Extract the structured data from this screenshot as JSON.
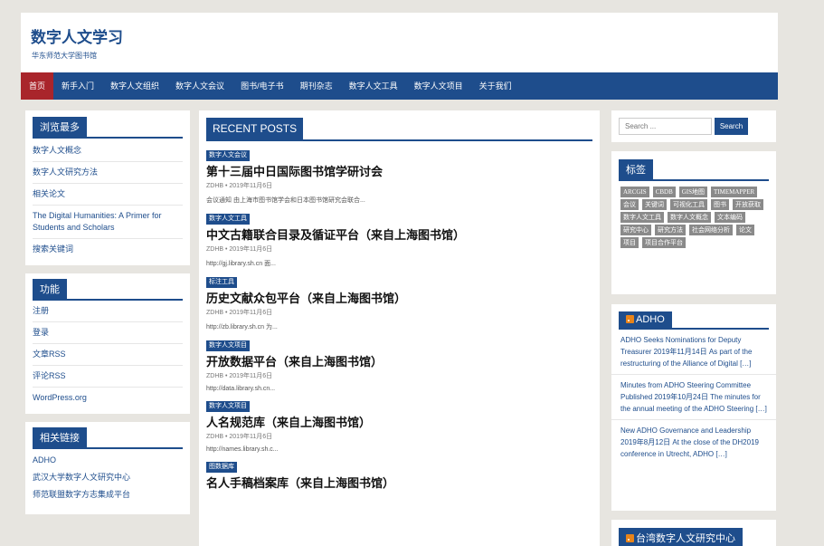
{
  "header": {
    "title": "数字人文学习",
    "subtitle": "华东师范大学图书馆"
  },
  "nav": [
    {
      "label": "首页",
      "active": true
    },
    {
      "label": "新手入门"
    },
    {
      "label": "数字人文组织"
    },
    {
      "label": "数字人文会议"
    },
    {
      "label": "图书/电子书"
    },
    {
      "label": "期刊杂志"
    },
    {
      "label": "数字人文工具"
    },
    {
      "label": "数字人文项目"
    },
    {
      "label": "关于我们"
    }
  ],
  "left": {
    "most_viewed": {
      "title": "浏览最多",
      "items": [
        "数字人文概念",
        "数字人文研究方法",
        "相关论文",
        "The Digital Humanities: A Primer for Students and Scholars",
        "搜索关键词"
      ]
    },
    "functions": {
      "title": "功能",
      "items": [
        "注册",
        "登录",
        "文章RSS",
        "评论RSS",
        "WordPress.org"
      ]
    },
    "links": {
      "title": "相关链接",
      "items": [
        "ADHO",
        "武汉大学数字人文研究中心",
        "师范联盟数字方志集成平台"
      ]
    }
  },
  "main": {
    "header": "RECENT POSTS",
    "posts": [
      {
        "category": "数字人文会议",
        "title": "第十三届中日国际图书馆学研讨会",
        "meta": "ZDHB • 2019年11月6日",
        "excerpt": "会议通知 由上海市图书馆学会和日本图书馆研究会联合..."
      },
      {
        "category": "数字人文工具",
        "title": "中文古籍联合目录及循证平台（来自上海图书馆）",
        "meta": "ZDHB • 2019年11月6日",
        "excerpt": "http://gj.library.sh.cn 面..."
      },
      {
        "category": "标注工具",
        "title": "历史文献众包平台（来自上海图书馆）",
        "meta": "ZDHB • 2019年11月6日",
        "excerpt": "http://zb.library.sh.cn 为..."
      },
      {
        "category": "数字人文项目",
        "title": "开放数据平台（来自上海图书馆）",
        "meta": "ZDHB • 2019年11月6日",
        "excerpt": "http://data.library.sh.cn..."
      },
      {
        "category": "数字人文项目",
        "title": "人名规范库（来自上海图书馆）",
        "meta": "ZDHB • 2019年11月6日",
        "excerpt": "http://names.library.sh.c..."
      },
      {
        "category": "图数据库",
        "title": "名人手稿档案库（来自上海图书馆）",
        "meta": "",
        "excerpt": ""
      }
    ]
  },
  "right": {
    "search": {
      "placeholder": "Search ...",
      "button": "Search"
    },
    "tags": {
      "title": "标签",
      "items": [
        "ARCGIS",
        "CBDB",
        "GIS地图",
        "TIMEMAPPER",
        "会议",
        "关键词",
        "可视化工具",
        "图书",
        "开放获取",
        "数字人文工具",
        "数字人文概念",
        "文本编码",
        "研究中心",
        "研究方法",
        "社会网络分析",
        "论文",
        "项目",
        "项目合作平台"
      ]
    },
    "adho": {
      "title": "ADHO",
      "entries": [
        "ADHO Seeks Nominations for Deputy Treasurer 2019年11月14日 As part of the restructuring of the Alliance of Digital […]",
        "Minutes from ADHO Steering Committee Published 2019年10月24日 The minutes for the annual meeting of the ADHO Steering […]",
        "New ADHO Governance and Leadership 2019年8月12日 At the close of the DH2019 conference in Utrecht, ADHO […]"
      ]
    },
    "taiwan": {
      "title": "台湾数字人文研究中心"
    }
  }
}
